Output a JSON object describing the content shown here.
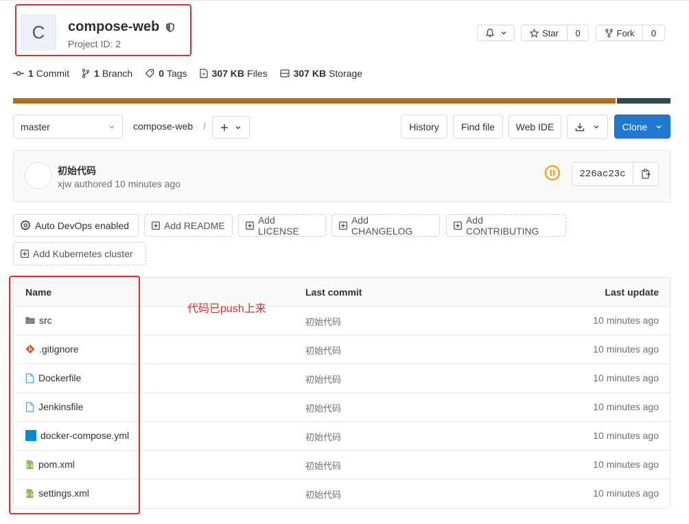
{
  "project": {
    "avatar_letter": "C",
    "name": "compose-web",
    "id_text": "Project ID: 2"
  },
  "actions": {
    "star_label": "Star",
    "star_count": "0",
    "fork_label": "Fork",
    "fork_count": "0"
  },
  "stats": [
    {
      "icon": "commit-icon",
      "value": "1",
      "label": "Commit"
    },
    {
      "icon": "branch-icon",
      "value": "1",
      "label": "Branch"
    },
    {
      "icon": "tag-icon",
      "value": "0",
      "label": "Tags"
    },
    {
      "icon": "file-icon",
      "value": "307 KB",
      "label": "Files"
    },
    {
      "icon": "storage-icon",
      "value": "307 KB",
      "label": "Storage"
    }
  ],
  "language_bar": {
    "segments": [
      {
        "color": "#b07219",
        "fraction": 0.918
      },
      {
        "color": "#2d4c54",
        "fraction": 0.082
      }
    ]
  },
  "nav": {
    "branch": "master",
    "breadcrumb": "compose-web",
    "separator": "/",
    "history": "History",
    "find_file": "Find file",
    "web_ide": "Web IDE",
    "clone": "Clone"
  },
  "commit": {
    "title": "初始代码",
    "meta": "xjw authored 10 minutes ago",
    "sha": "226ac23c",
    "pipeline_color": "#fc9403"
  },
  "shortcuts": {
    "auto_devops": "Auto DevOps enabled",
    "readme": "Add README",
    "license": "Add LICENSE",
    "changelog": "Add CHANGELOG",
    "contributing": "Add CONTRIBUTING",
    "kubernetes": "Add Kubernetes cluster"
  },
  "table": {
    "headers": {
      "name": "Name",
      "last_commit": "Last commit",
      "last_update": "Last update"
    },
    "rows": [
      {
        "name": "src",
        "icon": "folder-icon",
        "commit": "初始代码",
        "updated": "10 minutes ago"
      },
      {
        "name": ".gitignore",
        "icon": "git-icon",
        "commit": "初始代码",
        "updated": "10 minutes ago"
      },
      {
        "name": "Dockerfile",
        "icon": "file-icon",
        "commit": "初始代码",
        "updated": "10 minutes ago"
      },
      {
        "name": "Jenkinsfile",
        "icon": "file-icon",
        "commit": "初始代码",
        "updated": "10 minutes ago"
      },
      {
        "name": "docker-compose.yml",
        "icon": "docker-icon",
        "commit": "初始代码",
        "updated": "10 minutes ago"
      },
      {
        "name": "pom.xml",
        "icon": "xml-icon",
        "commit": "初始代码",
        "updated": "10 minutes ago"
      },
      {
        "name": "settings.xml",
        "icon": "xml-icon",
        "commit": "初始代码",
        "updated": "10 minutes ago"
      }
    ]
  },
  "annotation": "代码已push上来",
  "colors": {
    "accent": "#1f78d1",
    "highlight_box": "#e02c2c"
  }
}
